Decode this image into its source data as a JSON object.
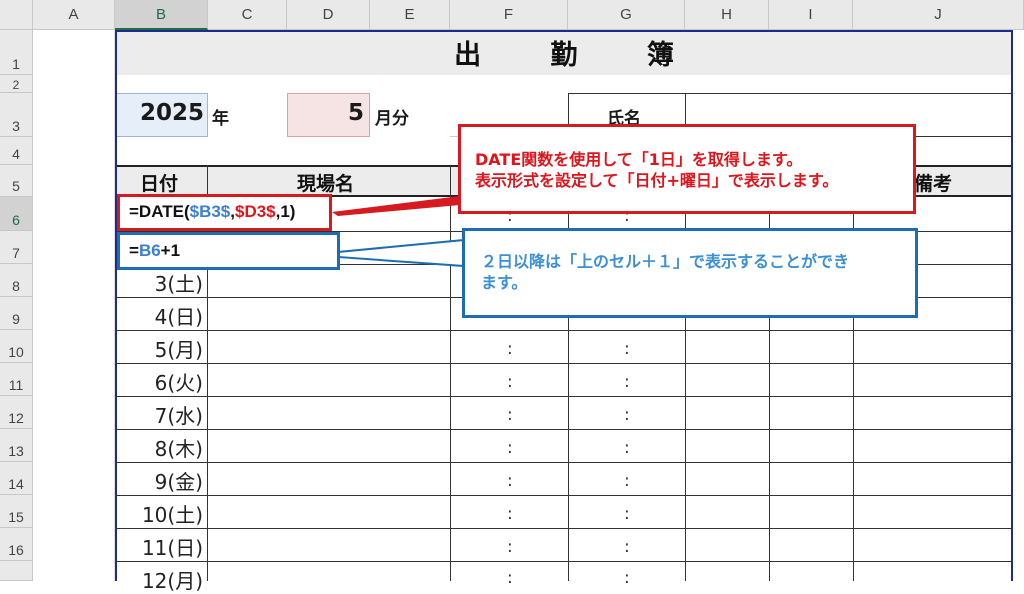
{
  "columns": [
    "A",
    "B",
    "C",
    "D",
    "E",
    "F",
    "G",
    "H",
    "I",
    "J"
  ],
  "rows": [
    "1",
    "2",
    "3",
    "4",
    "5",
    "6",
    "7",
    "8",
    "9",
    "10",
    "11",
    "12",
    "13",
    "14",
    "15",
    "16"
  ],
  "sheet": {
    "title": "出 勤 簿",
    "year_value": "2025",
    "year_unit": "年",
    "month_value": "5",
    "month_unit": "月分",
    "name_label": "氏名",
    "headers": {
      "date": "日付",
      "site": "現場名",
      "notes": "備考"
    },
    "dates": [
      "3(土)",
      "4(日)",
      "5(月)",
      "6(火)",
      "7(水)",
      "8(木)",
      "9(金)",
      "10(土)",
      "11(日)",
      "12(月)"
    ],
    "time_separator": ":"
  },
  "formulas": {
    "b6": {
      "prefix": "=DATE(",
      "arg1": "$B3$",
      "sep1": ",",
      "arg2": "$D3$",
      "rest": ",1)"
    },
    "b7": {
      "prefix": "=",
      "ref": "B6",
      "rest": "+1"
    }
  },
  "callouts": {
    "red": {
      "line1": "DATE関数を使用して「1日」を取得します。",
      "line2": "表示形式を設定して「日付+曜日」で表示します。"
    },
    "blue": {
      "line1": "２日以降は「上のセル＋１」で表示することができ",
      "line2": "ます。"
    }
  },
  "colors": {
    "selected_header": "#1f6e43",
    "frame": "#1d2a8f",
    "red": "#d71920",
    "blue": "#1c6db1"
  }
}
